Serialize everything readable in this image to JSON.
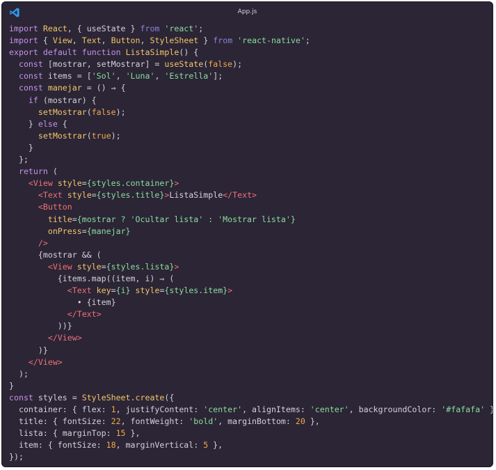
{
  "window": {
    "title": "App.js",
    "icon": "vscode-icon",
    "background": "#2b2535"
  },
  "editor": {
    "language": "javascript",
    "lines": [
      [
        [
          "kw",
          "import"
        ],
        [
          "pl",
          " "
        ],
        [
          "fn",
          "React"
        ],
        [
          "pl",
          ", { useState } "
        ],
        [
          "kw2",
          "from"
        ],
        [
          "pl",
          " "
        ],
        [
          "str",
          "'react'"
        ],
        [
          "pl",
          ";"
        ]
      ],
      [
        [
          "kw",
          "import"
        ],
        [
          "pl",
          " { "
        ],
        [
          "fn",
          "View"
        ],
        [
          "pl",
          ", "
        ],
        [
          "fn",
          "Text"
        ],
        [
          "pl",
          ", "
        ],
        [
          "fn",
          "Button"
        ],
        [
          "pl",
          ", "
        ],
        [
          "fn",
          "StyleSheet"
        ],
        [
          "pl",
          " } "
        ],
        [
          "kw2",
          "from"
        ],
        [
          "pl",
          " "
        ],
        [
          "str",
          "'react-native'"
        ],
        [
          "pl",
          ";"
        ]
      ],
      [
        [
          "kw",
          "export"
        ],
        [
          "pl",
          " "
        ],
        [
          "kw",
          "default"
        ],
        [
          "pl",
          " "
        ],
        [
          "kw",
          "function"
        ],
        [
          "pl",
          " "
        ],
        [
          "fn",
          "ListaSimple"
        ],
        [
          "pl",
          "() {"
        ]
      ],
      [
        [
          "pl",
          "  "
        ],
        [
          "kw",
          "const"
        ],
        [
          "pl",
          " [mostrar, setMostrar] = "
        ],
        [
          "fn",
          "useState"
        ],
        [
          "pl",
          "("
        ],
        [
          "bool",
          "false"
        ],
        [
          "pl",
          ");"
        ]
      ],
      [
        [
          "pl",
          "  "
        ],
        [
          "kw",
          "const"
        ],
        [
          "pl",
          " items = ["
        ],
        [
          "str",
          "'Sol'"
        ],
        [
          "pl",
          ", "
        ],
        [
          "str",
          "'Luna'"
        ],
        [
          "pl",
          ", "
        ],
        [
          "str",
          "'Estrella'"
        ],
        [
          "pl",
          "];"
        ]
      ],
      [
        [
          "pl",
          "  "
        ],
        [
          "kw",
          "const"
        ],
        [
          "pl",
          " "
        ],
        [
          "fn",
          "manejar"
        ],
        [
          "pl",
          " = () ⇒ {"
        ]
      ],
      [
        [
          "pl",
          "    "
        ],
        [
          "kw",
          "if"
        ],
        [
          "pl",
          " (mostrar) {"
        ]
      ],
      [
        [
          "pl",
          "      "
        ],
        [
          "fn",
          "setMostrar"
        ],
        [
          "pl",
          "("
        ],
        [
          "bool",
          "false"
        ],
        [
          "pl",
          ");"
        ]
      ],
      [
        [
          "pl",
          "    } "
        ],
        [
          "kw",
          "else"
        ],
        [
          "pl",
          " {"
        ]
      ],
      [
        [
          "pl",
          "      "
        ],
        [
          "fn",
          "setMostrar"
        ],
        [
          "pl",
          "("
        ],
        [
          "bool",
          "true"
        ],
        [
          "pl",
          ");"
        ]
      ],
      [
        [
          "pl",
          "    }"
        ]
      ],
      [
        [
          "pl",
          "  };"
        ]
      ],
      [
        [
          "pl",
          "  "
        ],
        [
          "kw",
          "return"
        ],
        [
          "pl",
          " ("
        ]
      ],
      [
        [
          "pl",
          "    "
        ],
        [
          "tag",
          "<View"
        ],
        [
          "pl",
          " "
        ],
        [
          "attr",
          "style"
        ],
        [
          "pl",
          "="
        ],
        [
          "str",
          "{styles.container}"
        ],
        [
          "tag",
          ">"
        ]
      ],
      [
        [
          "pl",
          "      "
        ],
        [
          "tag",
          "<Text"
        ],
        [
          "pl",
          " "
        ],
        [
          "attr",
          "style"
        ],
        [
          "pl",
          "="
        ],
        [
          "str",
          "{styles.title}"
        ],
        [
          "tag",
          ">"
        ],
        [
          "pl",
          "ListaSimple"
        ],
        [
          "tag",
          "</Text>"
        ]
      ],
      [
        [
          "pl",
          "      "
        ],
        [
          "tag",
          "<Button"
        ]
      ],
      [
        [
          "pl",
          "        "
        ],
        [
          "attr",
          "title"
        ],
        [
          "pl",
          "="
        ],
        [
          "str",
          "{mostrar ? 'Ocultar lista' : 'Mostrar lista'}"
        ]
      ],
      [
        [
          "pl",
          "        "
        ],
        [
          "attr",
          "onPress"
        ],
        [
          "pl",
          "="
        ],
        [
          "str",
          "{manejar}"
        ]
      ],
      [
        [
          "pl",
          "      "
        ],
        [
          "tag",
          "/>"
        ]
      ],
      [
        [
          "pl",
          "      {mostrar && ("
        ]
      ],
      [
        [
          "pl",
          "        "
        ],
        [
          "tag",
          "<View"
        ],
        [
          "pl",
          " "
        ],
        [
          "attr",
          "style"
        ],
        [
          "pl",
          "="
        ],
        [
          "str",
          "{styles.lista}"
        ],
        [
          "tag",
          ">"
        ]
      ],
      [
        [
          "pl",
          "          {items.map((item, i) ⇒ ("
        ]
      ],
      [
        [
          "pl",
          "            "
        ],
        [
          "tag",
          "<Text"
        ],
        [
          "pl",
          " "
        ],
        [
          "attr",
          "key"
        ],
        [
          "pl",
          "="
        ],
        [
          "str",
          "{i}"
        ],
        [
          "pl",
          " "
        ],
        [
          "attr",
          "style"
        ],
        [
          "pl",
          "="
        ],
        [
          "str",
          "{styles.item}"
        ],
        [
          "tag",
          ">"
        ]
      ],
      [
        [
          "pl",
          "              • {item}"
        ]
      ],
      [
        [
          "pl",
          "            "
        ],
        [
          "tag",
          "</Text>"
        ]
      ],
      [
        [
          "pl",
          "          ))}"
        ]
      ],
      [
        [
          "pl",
          "        "
        ],
        [
          "tag",
          "</View>"
        ]
      ],
      [
        [
          "pl",
          "      )}"
        ]
      ],
      [
        [
          "pl",
          "    "
        ],
        [
          "tag",
          "</View>"
        ]
      ],
      [
        [
          "pl",
          "  );"
        ]
      ],
      [
        [
          "pl",
          "}"
        ]
      ],
      [
        [
          "kw",
          "const"
        ],
        [
          "pl",
          " styles = "
        ],
        [
          "fn",
          "StyleSheet"
        ],
        [
          "pl",
          "."
        ],
        [
          "fn",
          "create"
        ],
        [
          "pl",
          "({"
        ]
      ],
      [
        [
          "pl",
          "  container: { flex: "
        ],
        [
          "num",
          "1"
        ],
        [
          "pl",
          ", justifyContent: "
        ],
        [
          "str",
          "'center'"
        ],
        [
          "pl",
          ", alignItems: "
        ],
        [
          "str",
          "'center'"
        ],
        [
          "pl",
          ", backgroundColor: "
        ],
        [
          "str",
          "'#fafafa'"
        ],
        [
          "pl",
          " },"
        ]
      ],
      [
        [
          "pl",
          "  title: { fontSize: "
        ],
        [
          "num",
          "22"
        ],
        [
          "pl",
          ", fontWeight: "
        ],
        [
          "str",
          "'bold'"
        ],
        [
          "pl",
          ", marginBottom: "
        ],
        [
          "num",
          "20"
        ],
        [
          "pl",
          " },"
        ]
      ],
      [
        [
          "pl",
          "  lista: { marginTop: "
        ],
        [
          "num",
          "15"
        ],
        [
          "pl",
          " },"
        ]
      ],
      [
        [
          "pl",
          "  item: { fontSize: "
        ],
        [
          "num",
          "18"
        ],
        [
          "pl",
          ", marginVertical: "
        ],
        [
          "num",
          "5"
        ],
        [
          "pl",
          " },"
        ]
      ],
      [
        [
          "pl",
          "});"
        ]
      ]
    ]
  }
}
